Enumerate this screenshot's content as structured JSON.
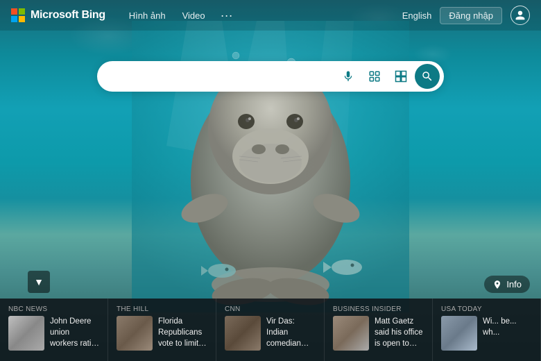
{
  "brand": {
    "logo_label": "Microsoft Bing",
    "name": "Microsoft Bing"
  },
  "navbar": {
    "links": [
      {
        "label": "Hình ảnh",
        "id": "images"
      },
      {
        "label": "Video",
        "id": "video"
      }
    ],
    "more_label": "···",
    "lang": "English",
    "login": "Đăng nhập"
  },
  "search": {
    "placeholder": "",
    "value": "",
    "mic_icon": "🎤",
    "camera_icon": "⊞",
    "grid_icon": "⊟",
    "search_icon": "🔍"
  },
  "scroll_btn": {
    "label": "▼"
  },
  "info_btn": {
    "label": "Info",
    "icon": "📍"
  },
  "news": [
    {
      "source": "NBC News",
      "headline": "John Deere union workers ratify new deal to end strike",
      "thumb_class": "thumb-nbc"
    },
    {
      "source": "The Hill",
      "headline": "Florida Republicans vote to limit vaccine mandates",
      "thumb_class": "thumb-hill"
    },
    {
      "source": "CNN",
      "headline": "Vir Das: Indian comedian polarizes nation with his tale of 'two Indias'",
      "thumb_class": "thumb-cnn"
    },
    {
      "source": "Business Insider",
      "headline": "Matt Gaetz said his office is open to hiring Kyle Rittenhouse as a c...",
      "thumb_class": "thumb-bi"
    },
    {
      "source": "USA TODAY",
      "headline": "Wi... be... wh...",
      "thumb_class": "thumb-usa"
    }
  ]
}
